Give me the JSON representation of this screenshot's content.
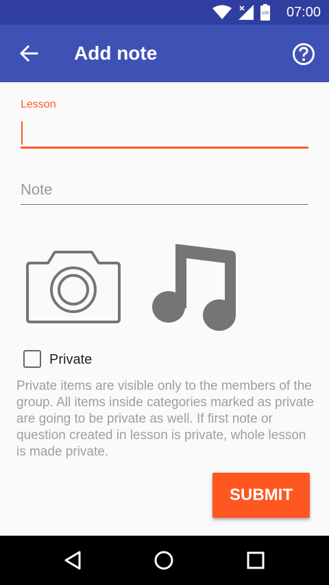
{
  "status": {
    "time": "07:00",
    "battery": "100"
  },
  "appbar": {
    "title": "Add note"
  },
  "form": {
    "lesson_label": "Lesson",
    "lesson_value": "",
    "note_placeholder": "Note",
    "private_label": "Private",
    "private_checked": false,
    "help_text": "Private items are visible only to the members of the group. All items inside categories marked as private are going to be private as well. If first note or question created in lesson is private, whole lesson is made private.",
    "submit_label": "SUBMIT"
  },
  "colors": {
    "primary": "#3f51b5",
    "primary_dark": "#303f9f",
    "accent": "#ff5722"
  }
}
